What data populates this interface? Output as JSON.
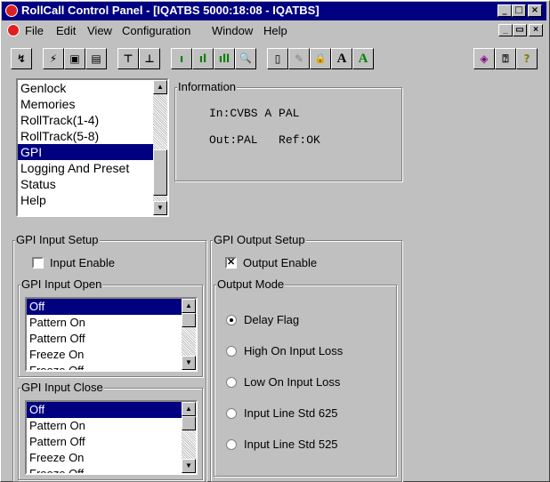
{
  "window": {
    "title": "RollCall Control Panel - [IQATBS 5000:18:08 - IQATBS]",
    "caption_buttons": [
      "_",
      "□",
      "×"
    ],
    "mdi_buttons": [
      "_",
      "ð",
      "×"
    ]
  },
  "menubar": {
    "items": [
      {
        "label": "File"
      },
      {
        "label": "Edit"
      },
      {
        "label": "View"
      },
      {
        "label": "Configuration"
      },
      {
        "label": "Window"
      },
      {
        "label": "Help"
      }
    ]
  },
  "toolbar": {
    "buttons": [
      {
        "icon": "connect-icon",
        "glyph": "↯"
      },
      {
        "icon": "lightning-icon",
        "glyph": "⚡"
      },
      {
        "icon": "save-icon",
        "glyph": "▣"
      },
      {
        "icon": "save-all-icon",
        "glyph": "▤"
      },
      {
        "icon": "network-icon",
        "glyph": "⊤"
      },
      {
        "icon": "device-icon",
        "glyph": "⊥"
      },
      {
        "icon": "level-low-icon",
        "glyph": "ı"
      },
      {
        "icon": "level-mid-icon",
        "glyph": "ıl"
      },
      {
        "icon": "level-high-icon",
        "glyph": "ıll"
      },
      {
        "icon": "search-icon",
        "glyph": "🔍"
      },
      {
        "icon": "book-icon",
        "glyph": "▯"
      },
      {
        "icon": "edit-icon",
        "glyph": "✎"
      },
      {
        "icon": "lock-icon",
        "glyph": "🔒"
      },
      {
        "icon": "font-a-icon",
        "glyph": "A"
      },
      {
        "icon": "font-a-green-icon",
        "glyph": "A"
      },
      {
        "icon": "help-book-icon",
        "glyph": "◈"
      },
      {
        "icon": "info-icon",
        "glyph": "⍰"
      },
      {
        "icon": "help-icon",
        "glyph": "?"
      }
    ]
  },
  "nav_list": {
    "items": [
      "Genlock",
      "Memories",
      "RollTrack(1-4)",
      "RollTrack(5-8)",
      "GPI",
      "Logging And Preset",
      "Status",
      "Help"
    ],
    "selected_index": 4
  },
  "information": {
    "label": "Information",
    "line1": "In:CVBS A PAL",
    "line2": "Out:PAL   Ref:OK"
  },
  "gpi_input_setup": {
    "label": "GPI Input Setup",
    "input_enable_label": "Input Enable",
    "input_enable_checked": false,
    "open": {
      "label": "GPI Input Open",
      "options": [
        "Off",
        "Pattern On",
        "Pattern Off",
        "Freeze On",
        "Freeze Off"
      ],
      "selected_index": 0
    },
    "close": {
      "label": "GPI Input Close",
      "options": [
        "Off",
        "Pattern On",
        "Pattern Off",
        "Freeze On",
        "Freeze Off"
      ],
      "selected_index": 0
    }
  },
  "gpi_output_setup": {
    "label": "GPI Output Setup",
    "output_enable_label": "Output Enable",
    "output_enable_checked": true,
    "output_mode": {
      "label": "Output Mode",
      "options": [
        "Delay Flag",
        "High On Input Loss",
        "Low On Input Loss",
        "Input Line Std 625",
        "Input Line Std 525"
      ],
      "selected_index": 0
    }
  },
  "colors": {
    "title_bar": "#000080",
    "face": "#c0c0c0",
    "selection": "#000080"
  }
}
